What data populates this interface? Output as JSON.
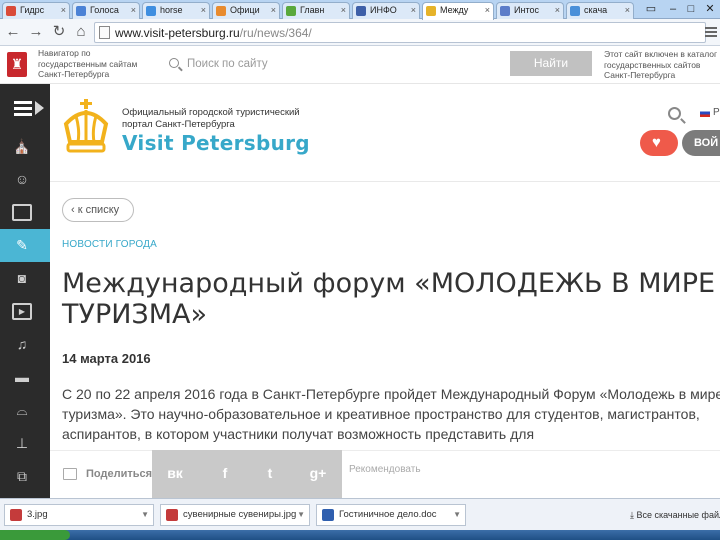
{
  "browser": {
    "tabs": [
      {
        "label": "Гидрс",
        "color": "#d94b3a"
      },
      {
        "label": "Голоса",
        "color": "#4b82d6"
      },
      {
        "label": "horse",
        "color": "#3e8ee0"
      },
      {
        "label": "Офици",
        "color": "#e88b2f"
      },
      {
        "label": "Главн",
        "color": "#5aa83c"
      },
      {
        "label": "ИНФО",
        "color": "#3d5fa8"
      },
      {
        "label": "Между",
        "color": "#e6b329"
      },
      {
        "label": "Интос",
        "color": "#5b7cc9"
      },
      {
        "label": "скача",
        "color": "#4a90d9"
      }
    ],
    "active_tab_index": 6,
    "url_host": "www.visit-petersburg.ru",
    "url_path": "/ru/news/364/"
  },
  "gov_banner": {
    "left_text": "Навигатор по государственным сайтам Санкт-Петербурга",
    "search_placeholder": "Поиск по сайту",
    "search_button": "Найти",
    "right_text": "Этот сайт включен в каталог государственных сайтов Санкт-Петербурга"
  },
  "site": {
    "portal_line": "Официальный городской туристический портал Санкт-Петербурга",
    "brand": "Visit Petersburg",
    "lang": "Р",
    "login": "ВОЙ",
    "accent": "#37a8c9"
  },
  "article": {
    "back": "к списку",
    "category": "НОВОСТИ ГОРОДА",
    "title": "Международный форум «МОЛОДЕЖЬ В МИРЕ ТУРИЗМА»",
    "date": "14 марта 2016",
    "body": "С 20 по 22 апреля 2016 года в Санкт-Петербурге пройдет Международный Форум «Молодежь в мире туризма». Это научно-образовательное и креативное пространство для студентов, магистрантов, аспирантов, в котором участники получат возможность представить для"
  },
  "share": {
    "label": "Поделиться",
    "networks": [
      "вк",
      "f",
      "t",
      "g+"
    ],
    "comment": "Рекомендовать"
  },
  "downloads": {
    "items": [
      {
        "label": "3.jpg",
        "color": "#c43b3b"
      },
      {
        "label": "сувенирные сувениры.jpg",
        "color": "#c43b3b"
      },
      {
        "label": "Гостиничное дело.doc",
        "color": "#2f5faf"
      }
    ],
    "show_all": "Все скачанные файлы"
  }
}
